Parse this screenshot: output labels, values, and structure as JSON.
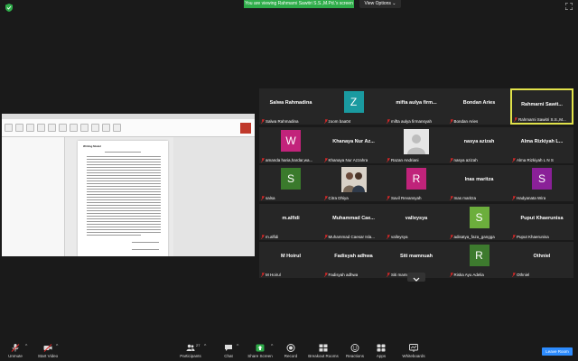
{
  "banner": {
    "text": "You are viewing Rahmarni Sawitri S.S.,M.Pd.'s screen"
  },
  "view_options": {
    "label": "View Options ⌄"
  },
  "shared_screen": {
    "doc_heading": "Writing Model"
  },
  "participants": [
    {
      "display": "Salwa Rahmadina",
      "label": "Salwa Rahmadina"
    },
    {
      "display": "Z",
      "label": "zoom baa04",
      "avatar_color": "#1a9aa0"
    },
    {
      "display": "mifta aulya firm...",
      "label": "mifta aulya firmansyah"
    },
    {
      "display": "Bondan Aries",
      "label": "Bondan Aries"
    },
    {
      "display": "Rahmarni Sawit...",
      "label": "Rahmarni Sawitri S.S.,M..."
    },
    {
      "display": "W",
      "label": "amanda haria,hardar,wa...",
      "avatar_color": "#c2237b"
    },
    {
      "display": "Khanaya Nur Az...",
      "label": "Khanaya Nur Azzahra"
    },
    {
      "display": "",
      "label": "Razan Andriani"
    },
    {
      "display": "nasya azizah",
      "label": "nasya azizah"
    },
    {
      "display": "Alma Rizkiyah L...",
      "label": "Alma Rizkiyah L N S"
    },
    {
      "display": "S",
      "label": "salsa",
      "avatar_color": "#3a7a2c"
    },
    {
      "display": "",
      "label": "Citra Dhiya"
    },
    {
      "display": "R",
      "label": "Savil Revansyah",
      "avatar_color": "#c0237a"
    },
    {
      "display": "Inas maritza",
      "label": "Inas maritza"
    },
    {
      "display": "S",
      "label": "Hadyanata Wira",
      "avatar_color": "#8a2098"
    },
    {
      "display": "m.alfidi",
      "label": "m.alfidi"
    },
    {
      "display": "Muhammad Cae...",
      "label": "Muhammad Caesar Isla..."
    },
    {
      "display": "valleysya",
      "label": "valleysya"
    },
    {
      "display": "S",
      "label": "adisatya_faza_gangga",
      "avatar_color": "#6cae3c"
    },
    {
      "display": "Puput Khaerunisa",
      "label": "Puput Khaerunisa"
    },
    {
      "display": "M Hoirul",
      "label": "M Hoirul"
    },
    {
      "display": "Fadisyah adhwa",
      "label": "Fadisyah adhwa"
    },
    {
      "display": "Siti mamnuah",
      "label": "Siti mamnuah"
    },
    {
      "display": "R",
      "label": "Riska Ayu Adelia",
      "avatar_color": "#3d7a2e"
    },
    {
      "display": "Othniel",
      "label": "Othniel"
    }
  ],
  "toolbar": {
    "unmute": "Unmute",
    "start_video": "Start Video",
    "participants": "Participants",
    "participants_count": "27",
    "chat": "Chat",
    "share_screen": "Share Screen",
    "record": "Record",
    "breakout_rooms": "Breakout Rooms",
    "reactions": "Reactions",
    "apps": "Apps",
    "whiteboards": "Whiteboards",
    "leave": "Leave Room"
  },
  "colors": {
    "banner_green": "#2fad4a",
    "active_border": "#e1e24a",
    "leave_blue": "#2d8cff"
  }
}
